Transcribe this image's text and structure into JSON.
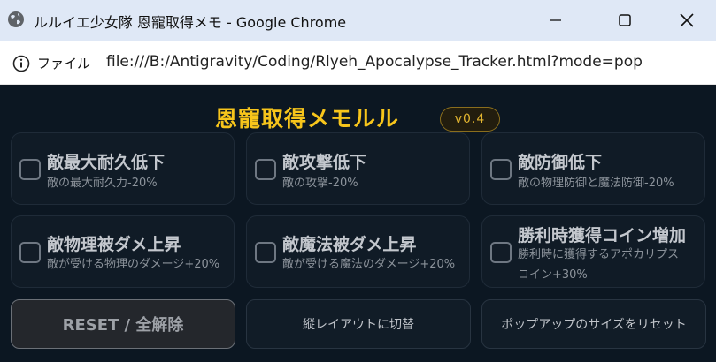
{
  "window": {
    "title": "ルルイエ少女隊 恩寵取得メモ - Google Chrome"
  },
  "addressbar": {
    "info_label": "ファイル",
    "url": "file:///B:/Antigravity/Coding/Rlyeh_Apocalypse_Tracker.html?mode=pop"
  },
  "app": {
    "title": "恩寵取得メモルル",
    "version": "v0.4"
  },
  "cards": [
    {
      "title": "敵最大耐久低下",
      "desc": "敵の最大耐久力-20%",
      "checked": false
    },
    {
      "title": "敵攻撃低下",
      "desc": "敵の攻撃-20%",
      "checked": false
    },
    {
      "title": "敵防御低下",
      "desc": "敵の物理防御と魔法防御-20%",
      "checked": false
    },
    {
      "title": "敵物理被ダメ上昇",
      "desc": "敵が受ける物理のダメージ+20%",
      "checked": false
    },
    {
      "title": "敵魔法被ダメ上昇",
      "desc": "敵が受ける魔法のダメージ+20%",
      "checked": false
    },
    {
      "title": "勝利時獲得コイン増加",
      "desc_line1": "勝利時に獲得するアポカリプス",
      "desc_line2": "コイン+30%",
      "checked": false
    }
  ],
  "buttons": {
    "reset": "RESET / 全解除",
    "layout": "縦レイアウトに切替",
    "popup_reset": "ポップアップのサイズをリセット"
  },
  "colors": {
    "accent": "#f7c51b",
    "background": "#0c1722",
    "card": "#101b26"
  }
}
